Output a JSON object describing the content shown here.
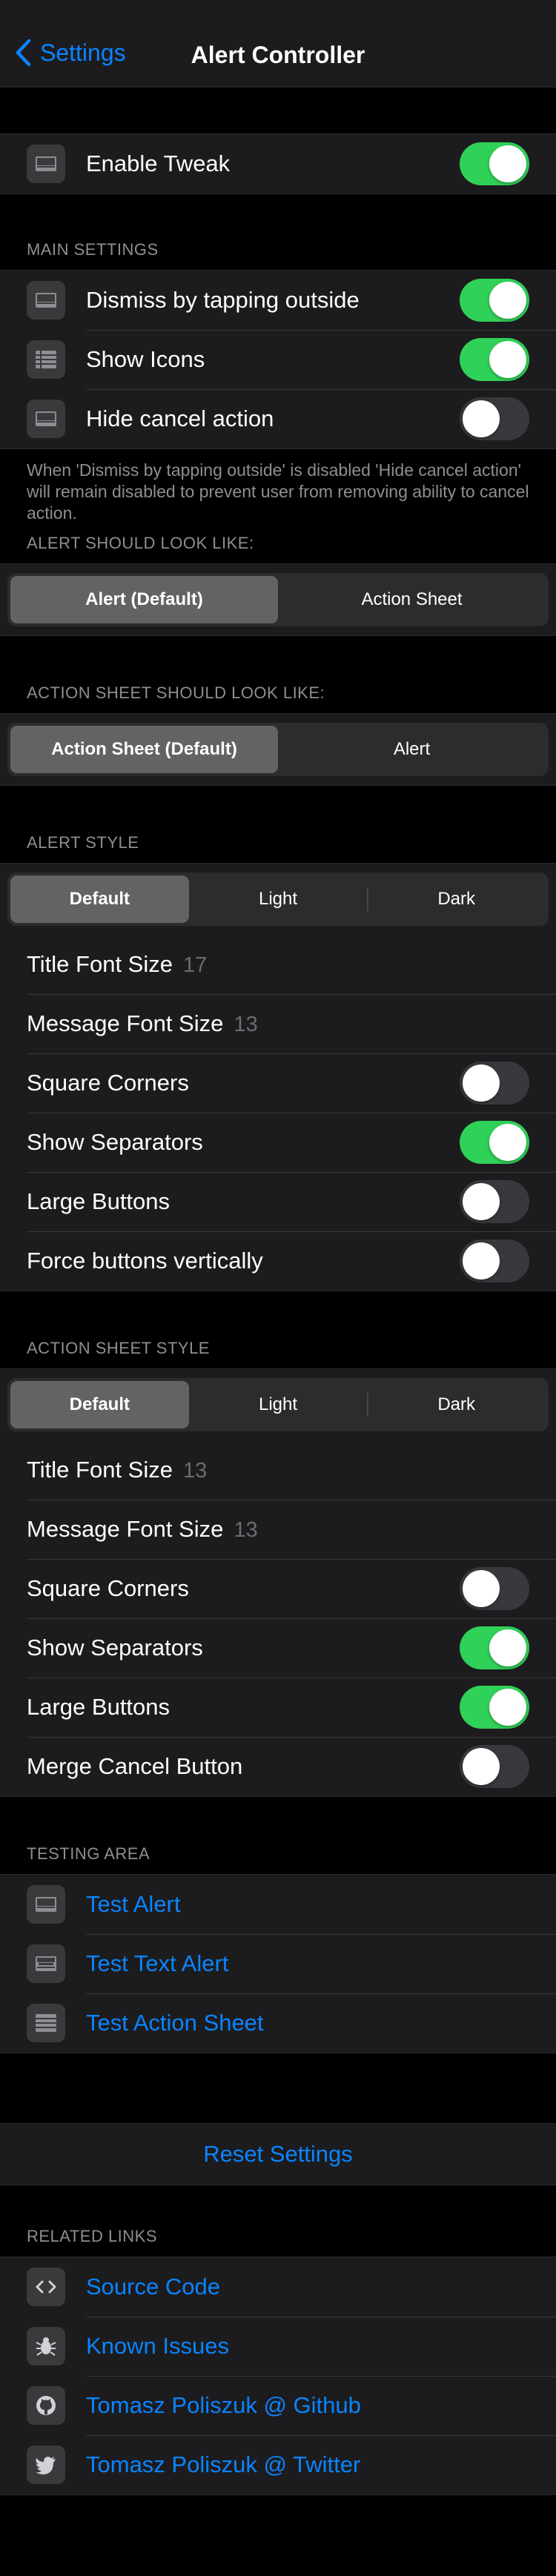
{
  "nav": {
    "back_label": "Settings",
    "title": "Alert Controller"
  },
  "enable": {
    "label": "Enable Tweak",
    "on": true
  },
  "main": {
    "header": "MAIN SETTINGS",
    "items": [
      {
        "label": "Dismiss by tapping outside",
        "on": true,
        "icon": "alert-icon"
      },
      {
        "label": "Show Icons",
        "on": true,
        "icon": "list-icon"
      },
      {
        "label": "Hide cancel action",
        "on": false,
        "icon": "alert-icon"
      }
    ],
    "footer": "When 'Dismiss by tapping outside' is disabled 'Hide cancel action' will remain disabled to prevent user from removing ability to cancel action."
  },
  "alert_look": {
    "header": "ALERT SHOULD LOOK LIKE:",
    "options": [
      "Alert (Default)",
      "Action Sheet"
    ],
    "selected": 0
  },
  "sheet_look": {
    "header": "ACTION SHEET SHOULD LOOK LIKE:",
    "options": [
      "Action Sheet (Default)",
      "Alert"
    ],
    "selected": 0
  },
  "alert_style": {
    "header": "ALERT STYLE",
    "options": [
      "Default",
      "Light",
      "Dark"
    ],
    "selected": 0,
    "title_font_label": "Title Font Size",
    "title_font_value": "17",
    "message_font_label": "Message Font Size",
    "message_font_value": "13",
    "toggles": [
      {
        "label": "Square Corners",
        "on": false
      },
      {
        "label": "Show Separators",
        "on": true
      },
      {
        "label": "Large Buttons",
        "on": false
      },
      {
        "label": "Force buttons vertically",
        "on": false
      }
    ]
  },
  "sheet_style": {
    "header": "ACTION SHEET STYLE",
    "options": [
      "Default",
      "Light",
      "Dark"
    ],
    "selected": 0,
    "title_font_label": "Title Font Size",
    "title_font_value": "13",
    "message_font_label": "Message Font Size",
    "message_font_value": "13",
    "toggles": [
      {
        "label": "Square Corners",
        "on": false
      },
      {
        "label": "Show Separators",
        "on": true
      },
      {
        "label": "Large Buttons",
        "on": true
      },
      {
        "label": "Merge Cancel Button",
        "on": false
      }
    ]
  },
  "testing": {
    "header": "TESTING AREA",
    "items": [
      {
        "label": "Test Alert",
        "icon": "alert-icon"
      },
      {
        "label": "Test Text Alert",
        "icon": "text-alert-icon"
      },
      {
        "label": "Test Action Sheet",
        "icon": "action-sheet-icon"
      }
    ]
  },
  "reset_label": "Reset Settings",
  "links": {
    "header": "RELATED LINKS",
    "items": [
      {
        "label": "Source Code",
        "icon": "code-icon"
      },
      {
        "label": "Known Issues",
        "icon": "bug-icon"
      },
      {
        "label": "Tomasz Poliszuk @ Github",
        "icon": "github-icon"
      },
      {
        "label": "Tomasz Poliszuk @ Twitter",
        "icon": "twitter-icon"
      }
    ]
  },
  "colors": {
    "accent": "#0a84ff",
    "toggle_on": "#30d158",
    "cell_bg": "#1c1c1e",
    "background": "#000000"
  }
}
